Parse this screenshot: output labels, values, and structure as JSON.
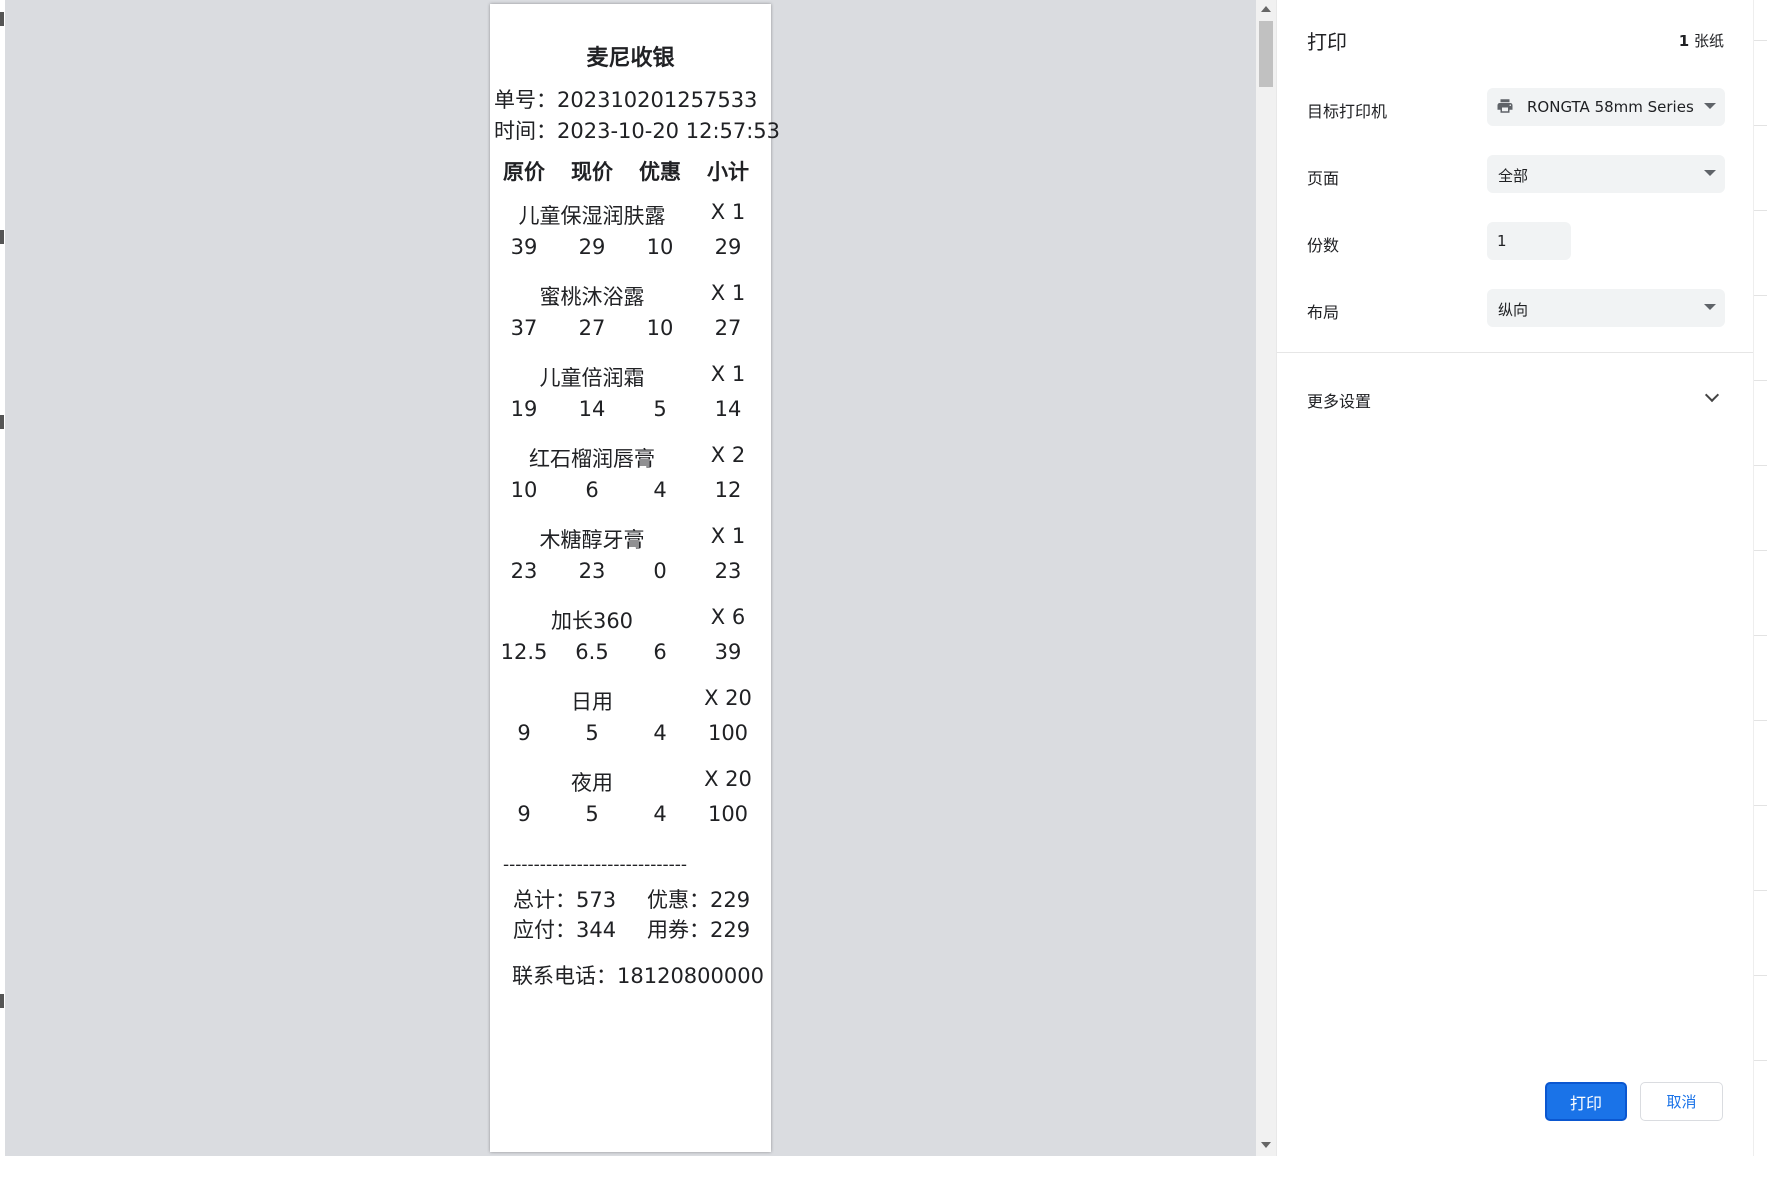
{
  "receipt": {
    "title": "麦尼收银",
    "order_no": "单号：202310201257533",
    "time": "时间：2023-10-20 12:57:53",
    "headers": [
      "原价",
      "现价",
      "优惠",
      "小计"
    ],
    "items": [
      {
        "name": "儿童保湿润肤露",
        "qty": "X 1",
        "values": [
          "39",
          "29",
          "10",
          "29"
        ]
      },
      {
        "name": "蜜桃沐浴露",
        "qty": "X 1",
        "values": [
          "37",
          "27",
          "10",
          "27"
        ]
      },
      {
        "name": "儿童倍润霜",
        "qty": "X 1",
        "values": [
          "19",
          "14",
          "5",
          "14"
        ]
      },
      {
        "name": "红石榴润唇膏",
        "qty": "X 2",
        "values": [
          "10",
          "6",
          "4",
          "12"
        ]
      },
      {
        "name": "木糖醇牙膏",
        "qty": "X 1",
        "values": [
          "23",
          "23",
          "0",
          "23"
        ]
      },
      {
        "name": "加长360",
        "qty": "X 6",
        "values": [
          "12.5",
          "6.5",
          "6",
          "39"
        ]
      },
      {
        "name": "日用",
        "qty": "X 20",
        "values": [
          "9",
          "5",
          "4",
          "100"
        ]
      },
      {
        "name": "夜用",
        "qty": "X 20",
        "values": [
          "9",
          "5",
          "4",
          "100"
        ]
      }
    ],
    "separator": "------------------------------",
    "total": "总计：573",
    "discount": "优惠：229",
    "payable": "应付：344",
    "coupon": "用券：229",
    "phone": "联系电话：18120800000"
  },
  "panel": {
    "title": "打印",
    "sheet_count_num": "1",
    "sheet_count_unit": "张纸",
    "printer_label": "目标打印机",
    "printer_value": "RONGTA 58mm Series",
    "printer_icon": "printer-icon",
    "pages_label": "页面",
    "pages_value": "全部",
    "copies_label": "份数",
    "copies_value": "1",
    "layout_label": "布局",
    "layout_value": "纵向",
    "more_settings": "更多设置",
    "print_button": "打印",
    "cancel_button": "取消"
  },
  "colors": {
    "primary": "#1a73e8",
    "preview_bg": "#dadce0",
    "field_bg": "#f1f3f4"
  }
}
